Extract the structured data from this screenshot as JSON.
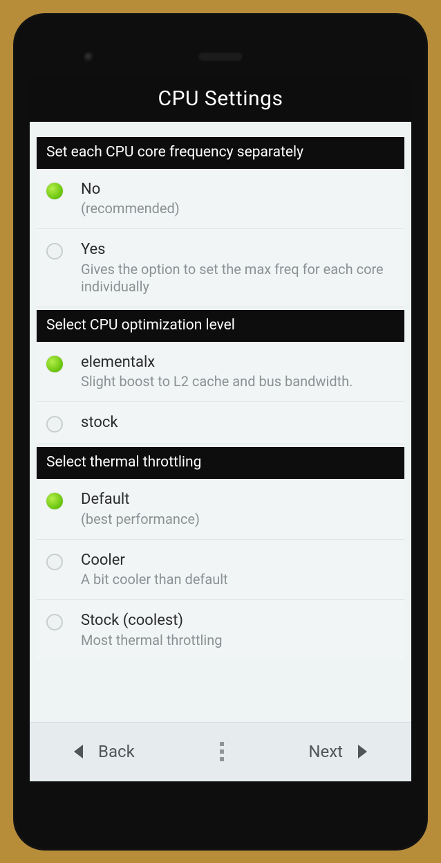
{
  "page_title": "CPU Settings",
  "sections": [
    {
      "header": "Set each CPU core frequency separately",
      "options": [
        {
          "title": "No",
          "subtitle": "(recommended)",
          "selected": true
        },
        {
          "title": "Yes",
          "subtitle": "Gives the option to set the max freq for each core individually",
          "selected": false
        }
      ]
    },
    {
      "header": "Select CPU optimization level",
      "options": [
        {
          "title": "elementalx",
          "subtitle": "Slight boost to L2 cache and bus bandwidth.",
          "selected": true
        },
        {
          "title": "stock",
          "subtitle": "",
          "selected": false
        }
      ]
    },
    {
      "header": "Select thermal throttling",
      "options": [
        {
          "title": "Default",
          "subtitle": "(best performance)",
          "selected": true
        },
        {
          "title": "Cooler",
          "subtitle": "A bit cooler than default",
          "selected": false
        },
        {
          "title": "Stock (coolest)",
          "subtitle": "Most thermal throttling",
          "selected": false
        }
      ]
    }
  ],
  "nav": {
    "back": "Back",
    "next": "Next"
  }
}
